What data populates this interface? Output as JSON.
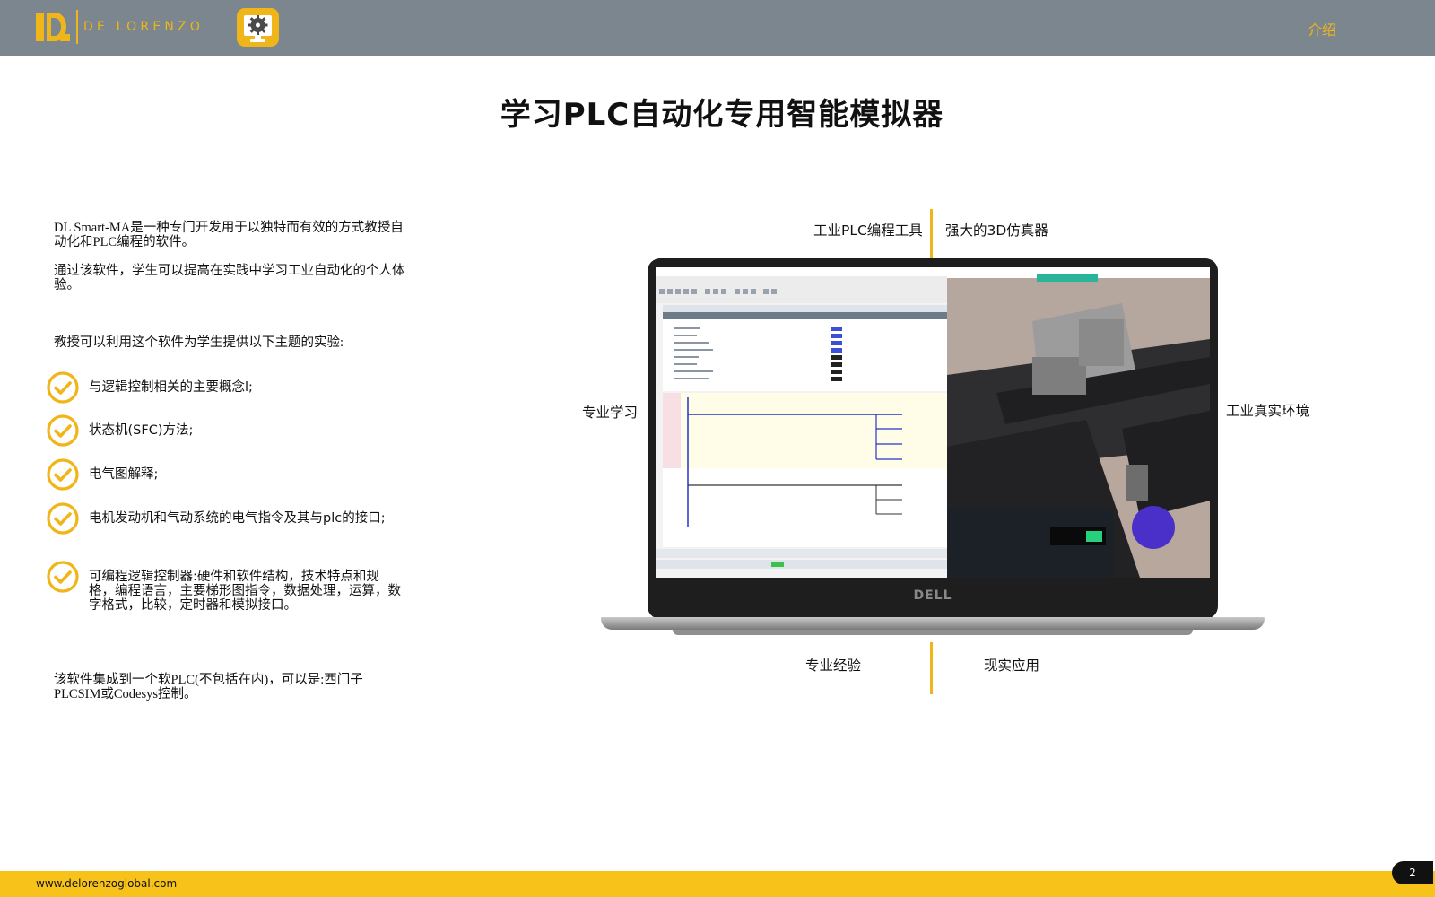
{
  "header": {
    "brand_name": "DE LORENZO",
    "nav_link": "介绍",
    "logo_icon": "dl-logo-icon",
    "app_icon": "gear-monitor-icon",
    "accent_color": "#f0b518",
    "bar_color": "#7b868f"
  },
  "page": {
    "title": "学习PLC自动化专用智能模拟器"
  },
  "intro": {
    "para1": "DL Smart-MA是一种专门开发用于以独特而有效的方式教授自动化和PLC编程的软件。",
    "para2": "通过该软件，学生可以提高在实践中学习工业自动化的个人体验。",
    "para3": "教授可以利用这个软件为学生提供以下主题的实验:",
    "para4": "该软件集成到一个软PLC(不包括在内)，可以是:西门子PLCSIM或Codesys控制。"
  },
  "topics": [
    {
      "label": "与逻辑控制相关的主要概念l;",
      "icon": "check-circle-icon"
    },
    {
      "label": "状态机(SFC)方法;",
      "icon": "check-circle-icon"
    },
    {
      "label": "电气图解释;",
      "icon": "check-circle-icon"
    },
    {
      "label": "电机发动机和气动系统的电气指令及其与plc的接口;",
      "icon": "check-circle-icon"
    },
    {
      "label": "可编程逻辑控制器:硬件和软件结构，技术特点和规格，编程语言，主要梯形图指令，数据处理，运算，数字格式，比较，定时器和模拟接口。",
      "icon": "check-circle-icon"
    }
  ],
  "diagram": {
    "top_left": "工业PLC编程工具",
    "top_right": "强大的3D仿真器",
    "left": "专业学习",
    "right": "工业真实环境",
    "bottom_left": "专业经验",
    "bottom_right": "现实应用",
    "laptop_brand": "DELL",
    "screenshot_desc_icon": "laptop-screenshot-image"
  },
  "footer": {
    "url": "www.delorenzoglobal.com",
    "page_number": "2"
  }
}
